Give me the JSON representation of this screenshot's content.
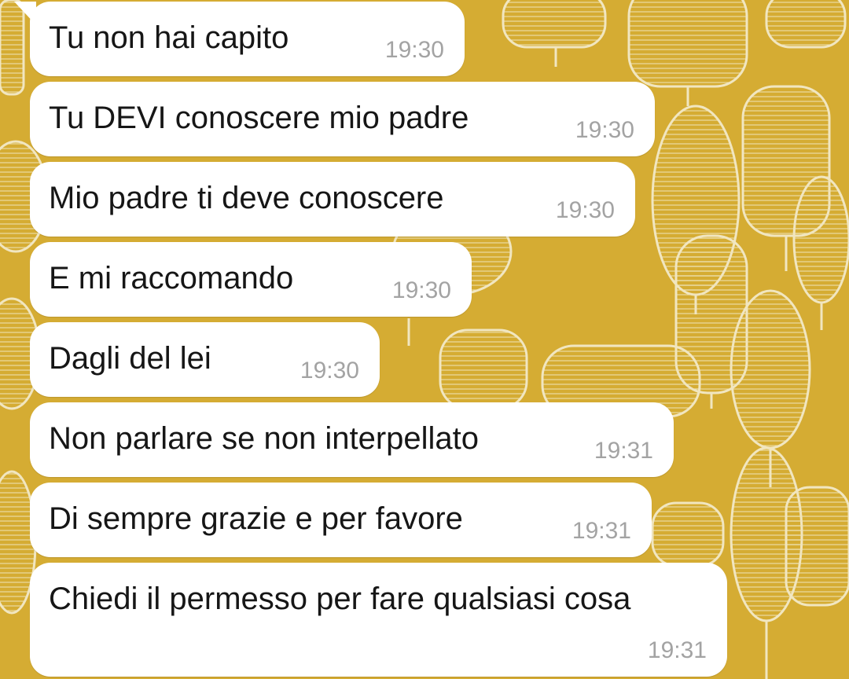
{
  "chat": {
    "messages": [
      {
        "text": "Tu non hai capito",
        "time": "19:30"
      },
      {
        "text": "Tu DEVI conoscere mio padre",
        "time": "19:30"
      },
      {
        "text": "Mio padre ti deve conoscere",
        "time": "19:30"
      },
      {
        "text": "E mi raccomando",
        "time": "19:30"
      },
      {
        "text": "Dagli del lei",
        "time": "19:30"
      },
      {
        "text": "Non parlare se non interpellato",
        "time": "19:31"
      },
      {
        "text": "Di sempre grazie e per favore",
        "time": "19:31"
      },
      {
        "text": "Chiedi il permesso per fare qualsiasi cosa",
        "time": "19:31"
      }
    ]
  },
  "colors": {
    "wallpaper": "#d5ac33",
    "bubble": "#ffffff",
    "text": "#161616",
    "timestamp": "#a3a3a3"
  }
}
